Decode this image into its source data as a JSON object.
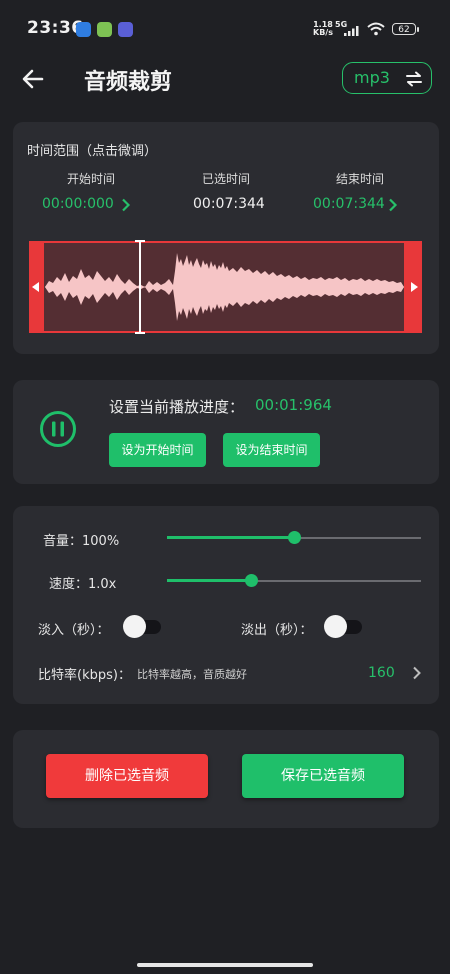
{
  "status_bar": {
    "time": "23:36",
    "net_speed_value": "1.18",
    "net_speed_unit": "KB/s",
    "network": "5G",
    "battery": "62"
  },
  "header": {
    "title": "音频裁剪",
    "format": "mp3"
  },
  "time_range": {
    "section_label": "时间范围（点击微调）",
    "start_label": "开始时间",
    "start_value": "00:00:000",
    "selected_label": "已选时间",
    "selected_value": "00:07:344",
    "end_label": "结束时间",
    "end_value": "00:07:344"
  },
  "playback": {
    "label": "设置当前播放进度：",
    "value": "00:01:964",
    "set_start_button": "设为开始时间",
    "set_end_button": "设为结束时间"
  },
  "settings": {
    "volume_label": "音量：100%",
    "volume_level": 0.5,
    "speed_label": "速度：1.0x",
    "speed_level": 0.33,
    "fade_in_label": "淡入（秒）：",
    "fade_in_on": false,
    "fade_out_label": "淡出（秒）：",
    "fade_out_on": false,
    "bitrate_label": "比特率(kbps)：",
    "bitrate_hint": "比特率越高，音质越好",
    "bitrate_value": "160"
  },
  "actions": {
    "delete_button": "删除已选音频",
    "save_button": "保存已选音频"
  },
  "colors": {
    "accent_green": "#1fbf6a",
    "danger_red": "#f03a3b",
    "background": "#1f2024",
    "card": "#2b2c31"
  }
}
